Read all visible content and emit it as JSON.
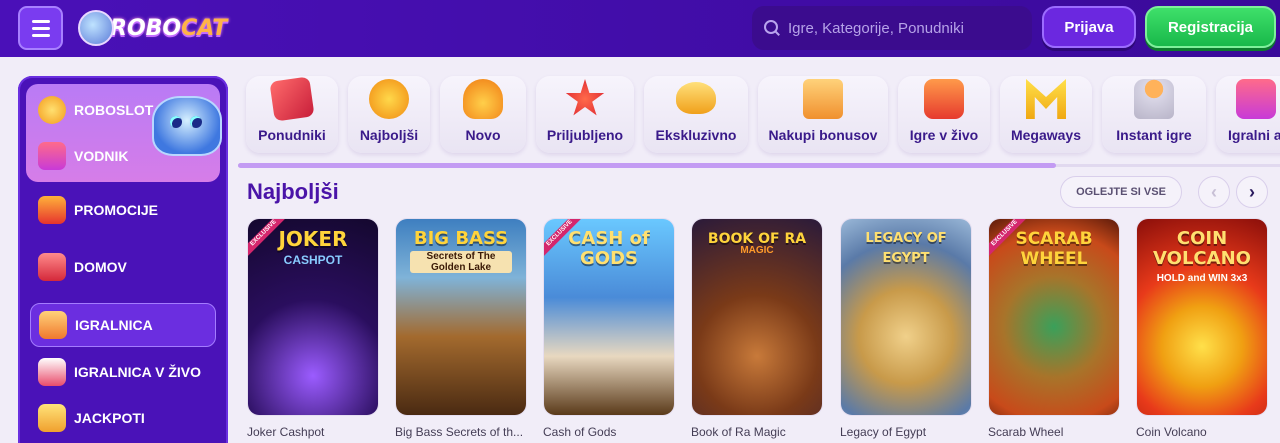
{
  "header": {
    "logo_text_a": "ROBO",
    "logo_text_b": "CAT",
    "search_placeholder": "Igre, Kategorije, Ponudniki",
    "login_label": "Prijava",
    "register_label": "Registracija"
  },
  "sidebar": {
    "items": [
      {
        "label": "ROBOSLOT",
        "icon": "coin-icon"
      },
      {
        "label": "VODNIK",
        "icon": "slot-icon"
      },
      {
        "label": "PROMOCIJE",
        "icon": "gift-icon"
      },
      {
        "label": "DOMOV",
        "icon": "home-icon"
      },
      {
        "label": "IGRALNICA",
        "icon": "slot-machine-icon"
      },
      {
        "label": "IGRALNICA V ŽIVO",
        "icon": "cards-icon"
      },
      {
        "label": "JACKPOTI",
        "icon": "jackpot-icon"
      }
    ]
  },
  "categories": [
    {
      "label": "Ponudniki",
      "icon": "providers-icon"
    },
    {
      "label": "Najboljši",
      "icon": "medal-icon"
    },
    {
      "label": "Novo",
      "icon": "bell-icon"
    },
    {
      "label": "Priljubljeno",
      "icon": "star-icon"
    },
    {
      "label": "Ekskluzivno",
      "icon": "gem-icon"
    },
    {
      "label": "Nakupi bonusov",
      "icon": "gift-box-icon"
    },
    {
      "label": "Igre v živo",
      "icon": "live-icon"
    },
    {
      "label": "Megaways",
      "icon": "megaways-icon"
    },
    {
      "label": "Instant igre",
      "icon": "joystick-icon"
    },
    {
      "label": "Igralni av",
      "icon": "slot-icon"
    }
  ],
  "section": {
    "title": "Najboljši",
    "see_all": "OGLEJTE SI VSE",
    "prev": "‹",
    "next": "›"
  },
  "games": [
    {
      "caption": "Joker Cashpot",
      "art_title": "JOKER",
      "art_sub": "CASHPOT",
      "exclusive": true,
      "exclusive_label": "EXCLUSIVE"
    },
    {
      "caption": "Big Bass Secrets of th...",
      "art_title": "BIG BASS",
      "art_sub": "Secrets of The Golden Lake",
      "exclusive": false
    },
    {
      "caption": "Cash of Gods",
      "art_title": "CASH of GODS",
      "art_sub": "",
      "exclusive": true,
      "exclusive_label": "EXCLUSIVE"
    },
    {
      "caption": "Book of Ra Magic",
      "art_title": "BOOK OF RA",
      "art_sub": "MAGIC",
      "exclusive": false
    },
    {
      "caption": "Legacy of Egypt",
      "art_title": "LEGACY OF EGYPT",
      "art_sub": "",
      "exclusive": false
    },
    {
      "caption": "Scarab Wheel",
      "art_title": "SCARAB WHEEL",
      "art_sub": "",
      "exclusive": true,
      "exclusive_label": "EXCLUSIVE"
    },
    {
      "caption": "Coin Volcano",
      "art_title": "COIN VOLCANO",
      "art_sub": "HOLD and WIN 3x3",
      "exclusive": false
    }
  ]
}
